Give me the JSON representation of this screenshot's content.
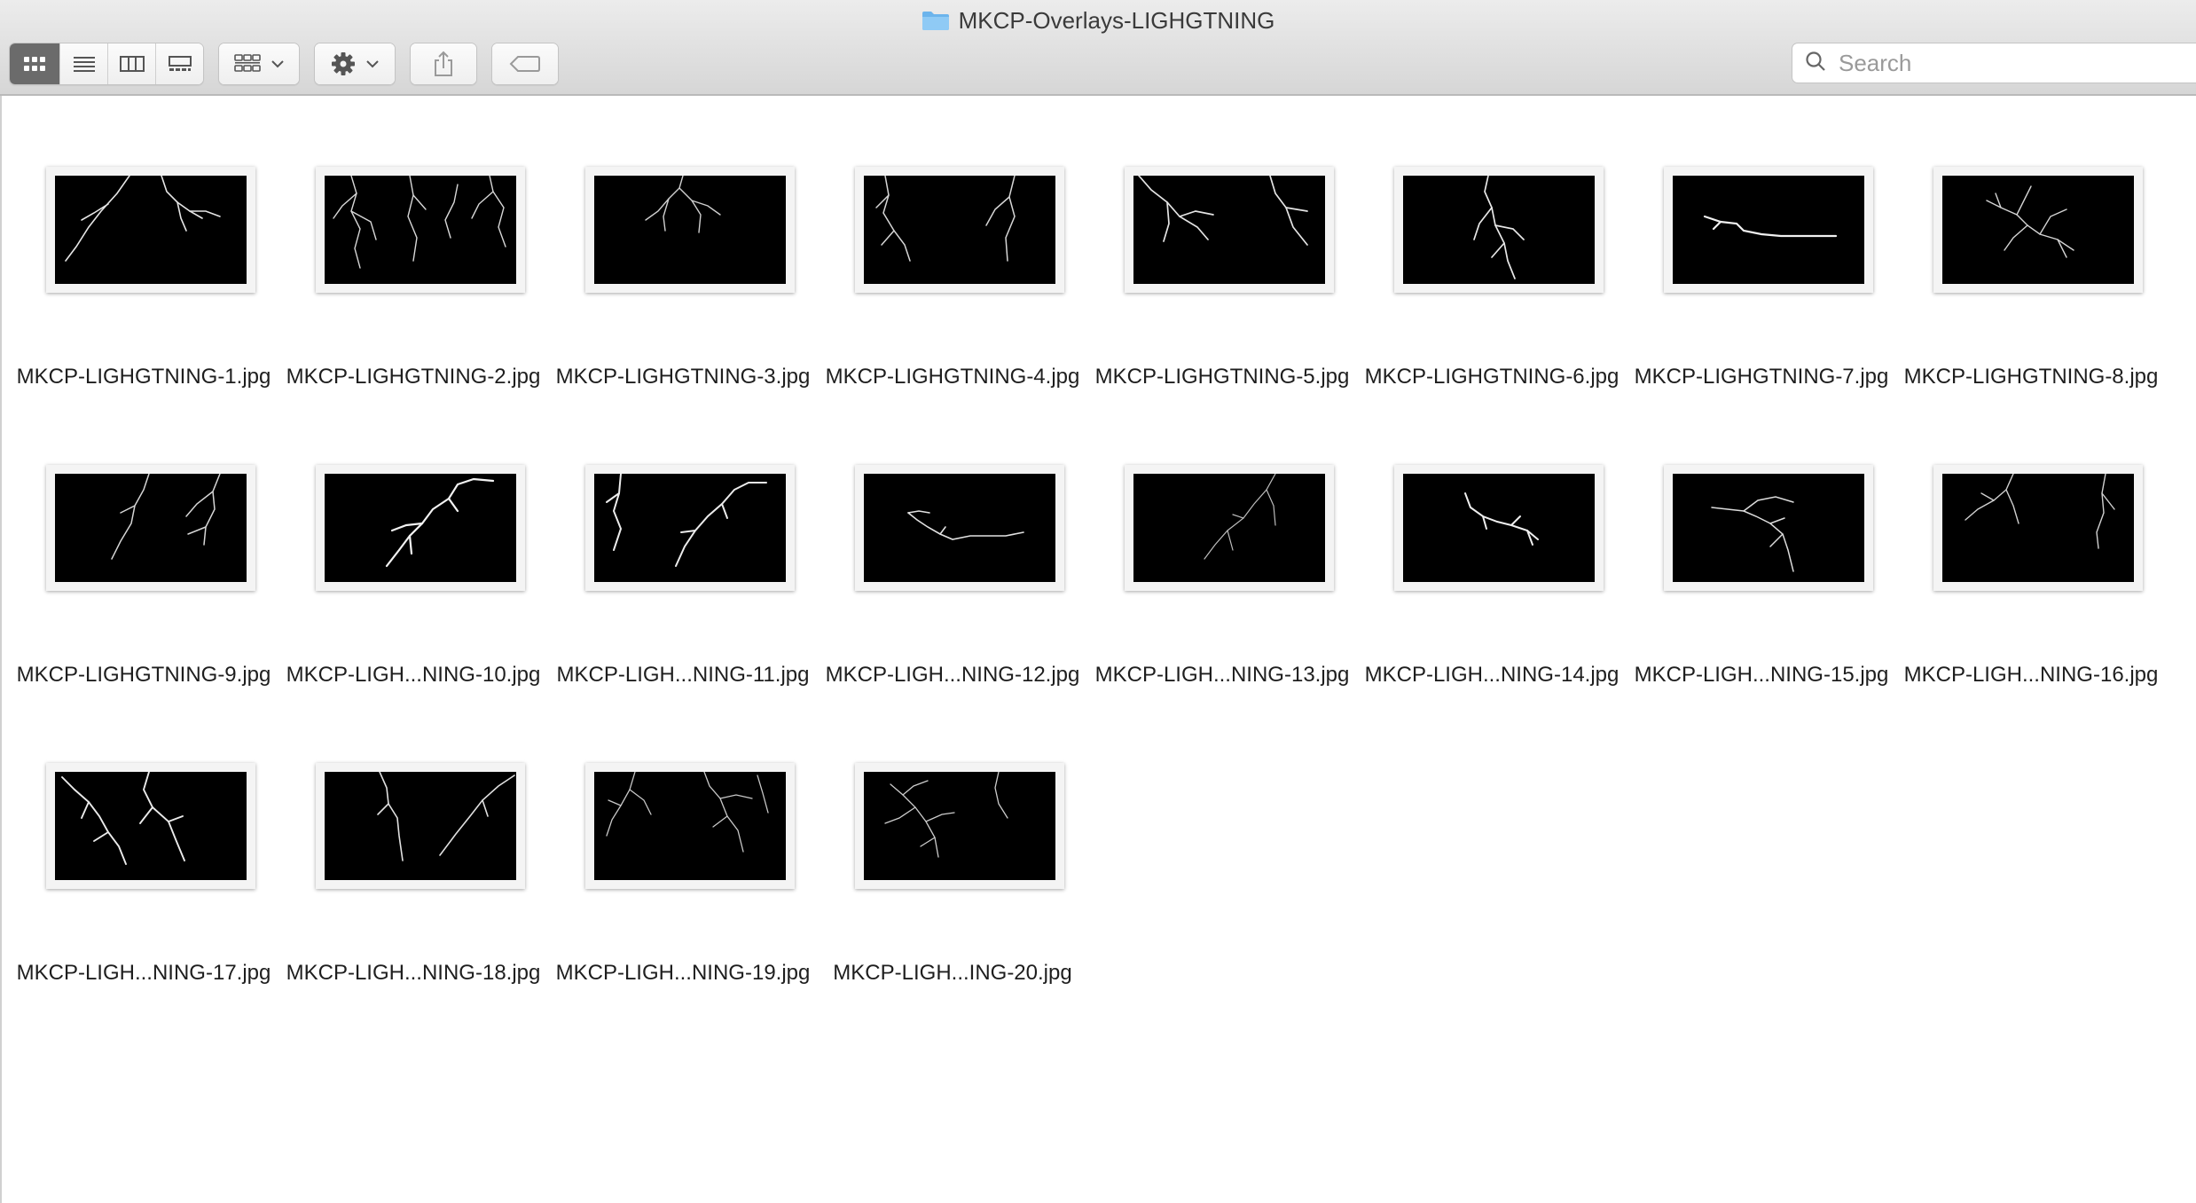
{
  "window": {
    "title": "MKCP-Overlays-LIGHGTNING",
    "folder_icon": "folder-icon"
  },
  "toolbar": {
    "view_buttons": [
      {
        "name": "icon-view",
        "icon": "grid-icon",
        "active": true
      },
      {
        "name": "list-view",
        "icon": "list-icon",
        "active": false
      },
      {
        "name": "column-view",
        "icon": "columns-icon",
        "active": false
      },
      {
        "name": "gallery-view",
        "icon": "gallery-icon",
        "active": false
      }
    ],
    "group_icon": "group-by-icon",
    "action_icon": "gear-icon",
    "share_icon": "share-icon",
    "tags_icon": "tag-icon",
    "search": {
      "placeholder": "Search",
      "value": ""
    }
  },
  "files": [
    {
      "name": "MKCP-LIGHGTNING-1.jpg"
    },
    {
      "name": "MKCP-LIGHGTNING-2.jpg"
    },
    {
      "name": "MKCP-LIGHGTNING-3.jpg"
    },
    {
      "name": "MKCP-LIGHGTNING-4.jpg"
    },
    {
      "name": "MKCP-LIGHGTNING-5.jpg"
    },
    {
      "name": "MKCP-LIGHGTNING-6.jpg"
    },
    {
      "name": "MKCP-LIGHGTNING-7.jpg"
    },
    {
      "name": "MKCP-LIGHGTNING-8.jpg"
    },
    {
      "name": "MKCP-LIGHGTNING-9.jpg"
    },
    {
      "name": "MKCP-LIGH...NING-10.jpg"
    },
    {
      "name": "MKCP-LIGH...NING-11.jpg"
    },
    {
      "name": "MKCP-LIGH...NING-12.jpg"
    },
    {
      "name": "MKCP-LIGH...NING-13.jpg"
    },
    {
      "name": "MKCP-LIGH...NING-14.jpg"
    },
    {
      "name": "MKCP-LIGH...NING-15.jpg"
    },
    {
      "name": "MKCP-LIGH...NING-16.jpg"
    },
    {
      "name": "MKCP-LIGH...NING-17.jpg"
    },
    {
      "name": "MKCP-LIGH...NING-18.jpg"
    },
    {
      "name": "MKCP-LIGH...NING-19.jpg"
    },
    {
      "name": "MKCP-LIGH...ING-20.jpg"
    }
  ]
}
